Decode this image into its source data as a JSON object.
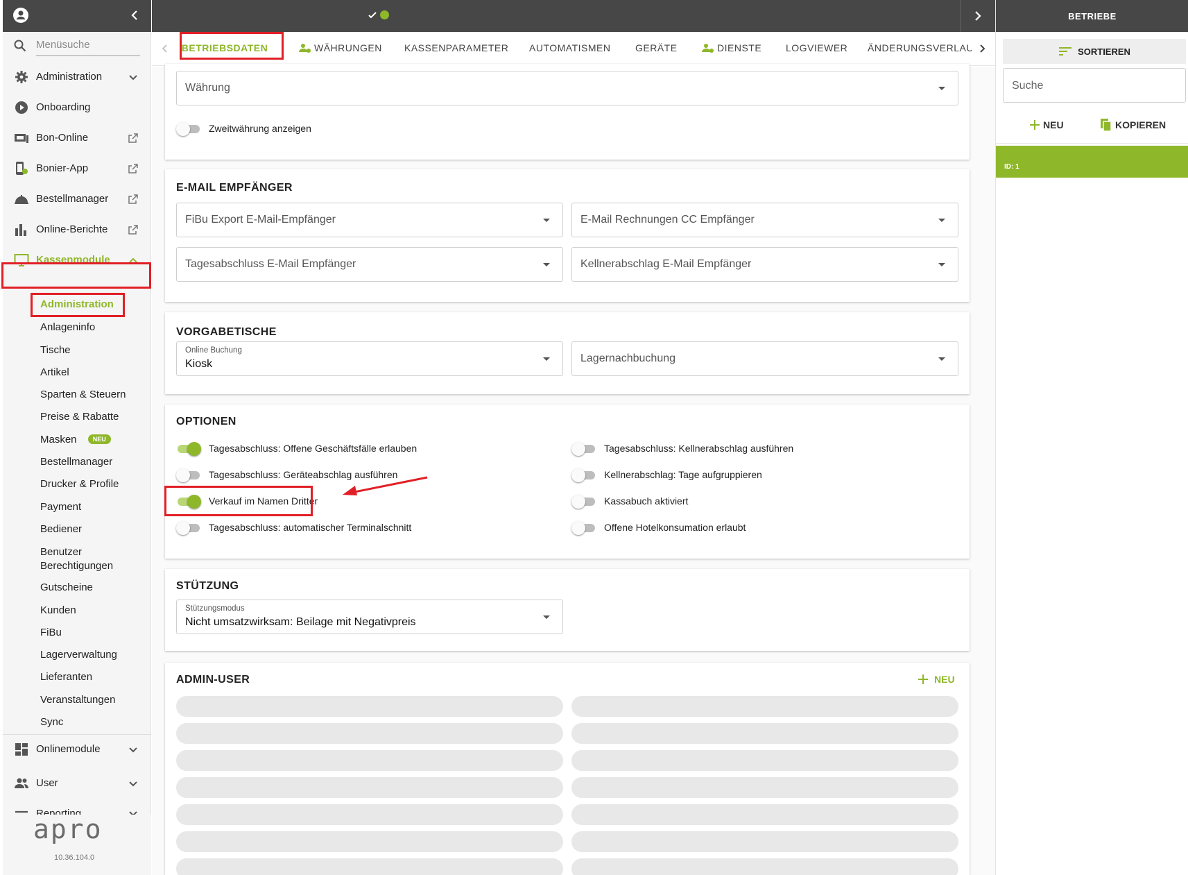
{
  "colors": {
    "accent": "#8fb72a",
    "dark": "#474747",
    "highlight": "#e11f26"
  },
  "sidebar": {
    "search_placeholder": "Menüsuche",
    "items": [
      {
        "label": "Administration",
        "icon": "gear-icon"
      },
      {
        "label": "Onboarding",
        "icon": "play-circle-icon"
      },
      {
        "label": "Bon-Online",
        "icon": "receipt-icon"
      },
      {
        "label": "Bonier-App",
        "icon": "phone-app-icon"
      },
      {
        "label": "Bestellmanager",
        "icon": "cloche-icon"
      },
      {
        "label": "Online-Berichte",
        "icon": "bar-chart-icon"
      },
      {
        "label": "Kassenmodule",
        "icon": "monitor-icon"
      }
    ],
    "subitems": [
      "Administration",
      "Anlageninfo",
      "Tische",
      "Artikel",
      "Sparten & Steuern",
      "Preise & Rabatte",
      "Masken",
      "Bestellmanager",
      "Drucker & Profile",
      "Payment",
      "Bediener",
      "Benutzer Berechtigungen",
      "Gutscheine",
      "Kunden",
      "FiBu",
      "Lagerverwaltung",
      "Lieferanten",
      "Veranstaltungen",
      "Sync"
    ],
    "new_badge": "NEU",
    "bottom_items": [
      {
        "label": "Onlinemodule",
        "icon": "dashboard-icon"
      },
      {
        "label": "User",
        "icon": "users-icon"
      },
      {
        "label": "Reporting",
        "icon": "menu-icon"
      }
    ],
    "logo_text": "apro",
    "version": "10.36.104.0"
  },
  "tabs": [
    "BETRIEBSDATEN",
    "WÄHRUNGEN",
    "KASSENPARAMETER",
    "AUTOMATISMEN",
    "GERÄTE",
    "DIENSTE",
    "LOGVIEWER",
    "ÄNDERUNGSVERLAUF"
  ],
  "currency": {
    "field": "Währung",
    "toggle": "Zweitwährung anzeigen"
  },
  "email": {
    "title": "E-MAIL EMPFÄNGER",
    "fields": [
      "FiBu Export E-Mail-Empfänger",
      "E-Mail Rechnungen CC Empfänger",
      "Tagesabschluss E-Mail Empfänger",
      "Kellnerabschlag E-Mail Empfänger"
    ]
  },
  "vorgabe": {
    "title": "VORGABETISCHE",
    "online_label": "Online Buchung",
    "online_value": "Kiosk",
    "lager": "Lagernachbuchung"
  },
  "optionen": {
    "title": "OPTIONEN",
    "left": [
      {
        "label": "Tagesabschluss: Offene Geschäftsfälle erlauben",
        "on": true
      },
      {
        "label": "Tagesabschluss: Geräteabschlag ausführen",
        "on": false
      },
      {
        "label": "Verkauf im Namen Dritter",
        "on": true
      },
      {
        "label": "Tagesabschluss: automatischer Terminalschnitt",
        "on": false
      }
    ],
    "right": [
      {
        "label": "Tagesabschluss: Kellnerabschlag ausführen",
        "on": false
      },
      {
        "label": "Kellnerabschlag: Tage aufgruppieren",
        "on": false
      },
      {
        "label": "Kassabuch aktiviert",
        "on": false
      },
      {
        "label": "Offene Hotelkonsumation erlaubt",
        "on": false
      }
    ]
  },
  "stuetzung": {
    "title": "STÜTZUNG",
    "label": "Stützungsmodus",
    "value": "Nicht umsatzwirksam: Beilage mit Negativpreis"
  },
  "admin": {
    "title": "ADMIN-USER",
    "new_label": "NEU"
  },
  "right_panel": {
    "title": "BETRIEBE",
    "sort_label": "SORTIEREN",
    "search_placeholder": "Suche",
    "new_label": "NEU",
    "copy_label": "KOPIEREN",
    "selected": "ID: 1"
  }
}
